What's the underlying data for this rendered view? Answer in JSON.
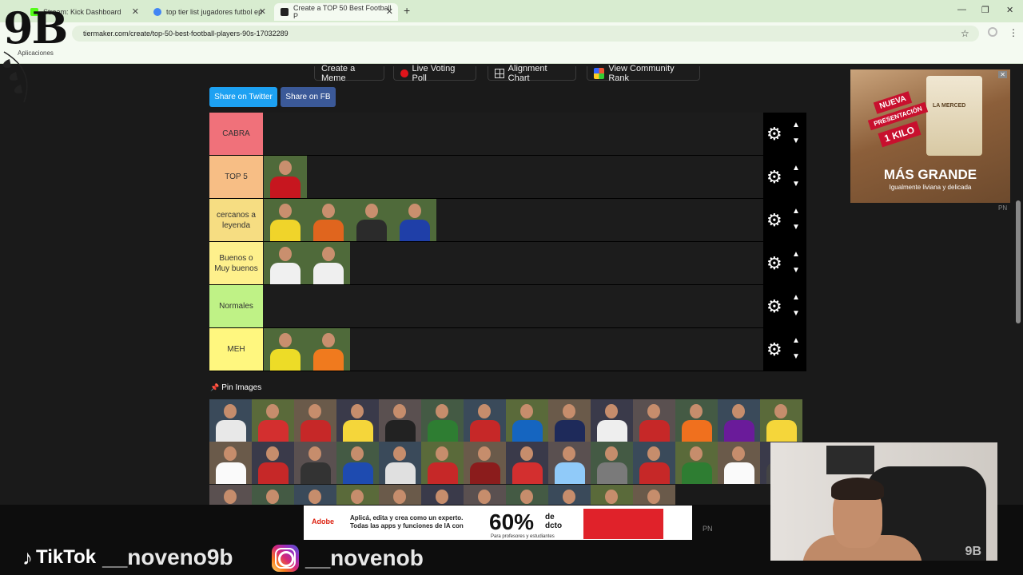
{
  "browser": {
    "tabs": [
      {
        "title": "Stream: Kick Dashboard",
        "active": false,
        "favicon_color": "#53fc18"
      },
      {
        "title": "top tier list jugadores futbol ep",
        "active": false,
        "favicon_color": "#4285f4"
      },
      {
        "title": "Create a TOP 50 Best Football P",
        "active": true,
        "favicon_color": "#222222"
      }
    ],
    "new_tab": "+",
    "url": "tiermaker.com/create/top-50-best-football-players-90s-17032289",
    "bookmarks_label": "Aplicaciones",
    "controls": {
      "minimize": "—",
      "restore": "❐",
      "close": "✕"
    }
  },
  "logo": "9B",
  "toolbar": {
    "create_meme": "Create a Meme",
    "live_voting": "Live Voting Poll",
    "alignment_chart": "Alignment Chart",
    "community_rank": "View Community Rank"
  },
  "share": {
    "twitter": "Share on Twitter",
    "facebook": "Share on FB"
  },
  "tiers": [
    {
      "label": "CABRA",
      "color": "#f0717a",
      "items": []
    },
    {
      "label": "TOP 5",
      "color": "#f7be85",
      "items": [
        {
          "kit": "#c7161f"
        }
      ]
    },
    {
      "label": "cercanos a leyenda",
      "color": "#f6dd82",
      "items": [
        {
          "kit": "#f0d42a"
        },
        {
          "kit": "#e0651e"
        },
        {
          "kit": "#2b2b2b"
        },
        {
          "kit": "#1f3fa8"
        }
      ]
    },
    {
      "label": "Buenos o Muy buenos",
      "color": "#fef08c",
      "items": [
        {
          "kit": "#f0f0f0"
        },
        {
          "kit": "#efefef"
        }
      ]
    },
    {
      "label": "Normales",
      "color": "#bff286",
      "items": []
    },
    {
      "label": "MEH",
      "color": "#fff77f",
      "items": [
        {
          "kit": "#eddc27"
        },
        {
          "kit": "#f07a1e"
        }
      ]
    }
  ],
  "pin_images": "Pin Images",
  "pool": [
    "#e8e8e8",
    "#d32f2f",
    "#c62828",
    "#f5d63a",
    "#222222",
    "#2e7d32",
    "#c62828",
    "#1565c0",
    "#1e2a5a",
    "#eeeeee",
    "#c62828",
    "#f0701e",
    "#6a1b9a",
    "#f5d63a",
    "#fafafa",
    "#c62828",
    "#333333",
    "#1e4bb0",
    "#e0e0e0",
    "#c62828",
    "#8b1c1c",
    "#d32f2f",
    "#90caf9",
    "#7a7a7a",
    "#c62828",
    "#2e7d32",
    "#fafafa",
    "#444444",
    "#333333",
    "#eeeeee",
    "#222222",
    "#d32f2f",
    "#eeeeee",
    "#c62828",
    "#d32f2f",
    "#eeeeee",
    "#f5d63a",
    "#ffffff",
    "#1565c0"
  ],
  "ad_right": {
    "ribbon1": "NUEVA",
    "ribbon2": "PRESENTACIÓN",
    "ribbon3": "1 KILO",
    "headline": "MÁS GRANDE",
    "subline": "Igualmente liviana y delicada",
    "brand": "LA MERCED",
    "pn": "PN"
  },
  "ad_bottom": {
    "brand": "Adobe",
    "line1": "Aplicá, edita y crea como un experto.",
    "line2": "Todas las apps y funciones de IA con",
    "percent": "60%",
    "dcto1": "de",
    "dcto2": "dcto",
    "small": "Para profesores y estudiantes",
    "pn": "PN"
  },
  "social": {
    "tiktok_brand": "TikTok",
    "tiktok_handle": "__noveno9b",
    "instagram_handle": "__novenob"
  },
  "cam": {
    "watermark": "9B"
  }
}
